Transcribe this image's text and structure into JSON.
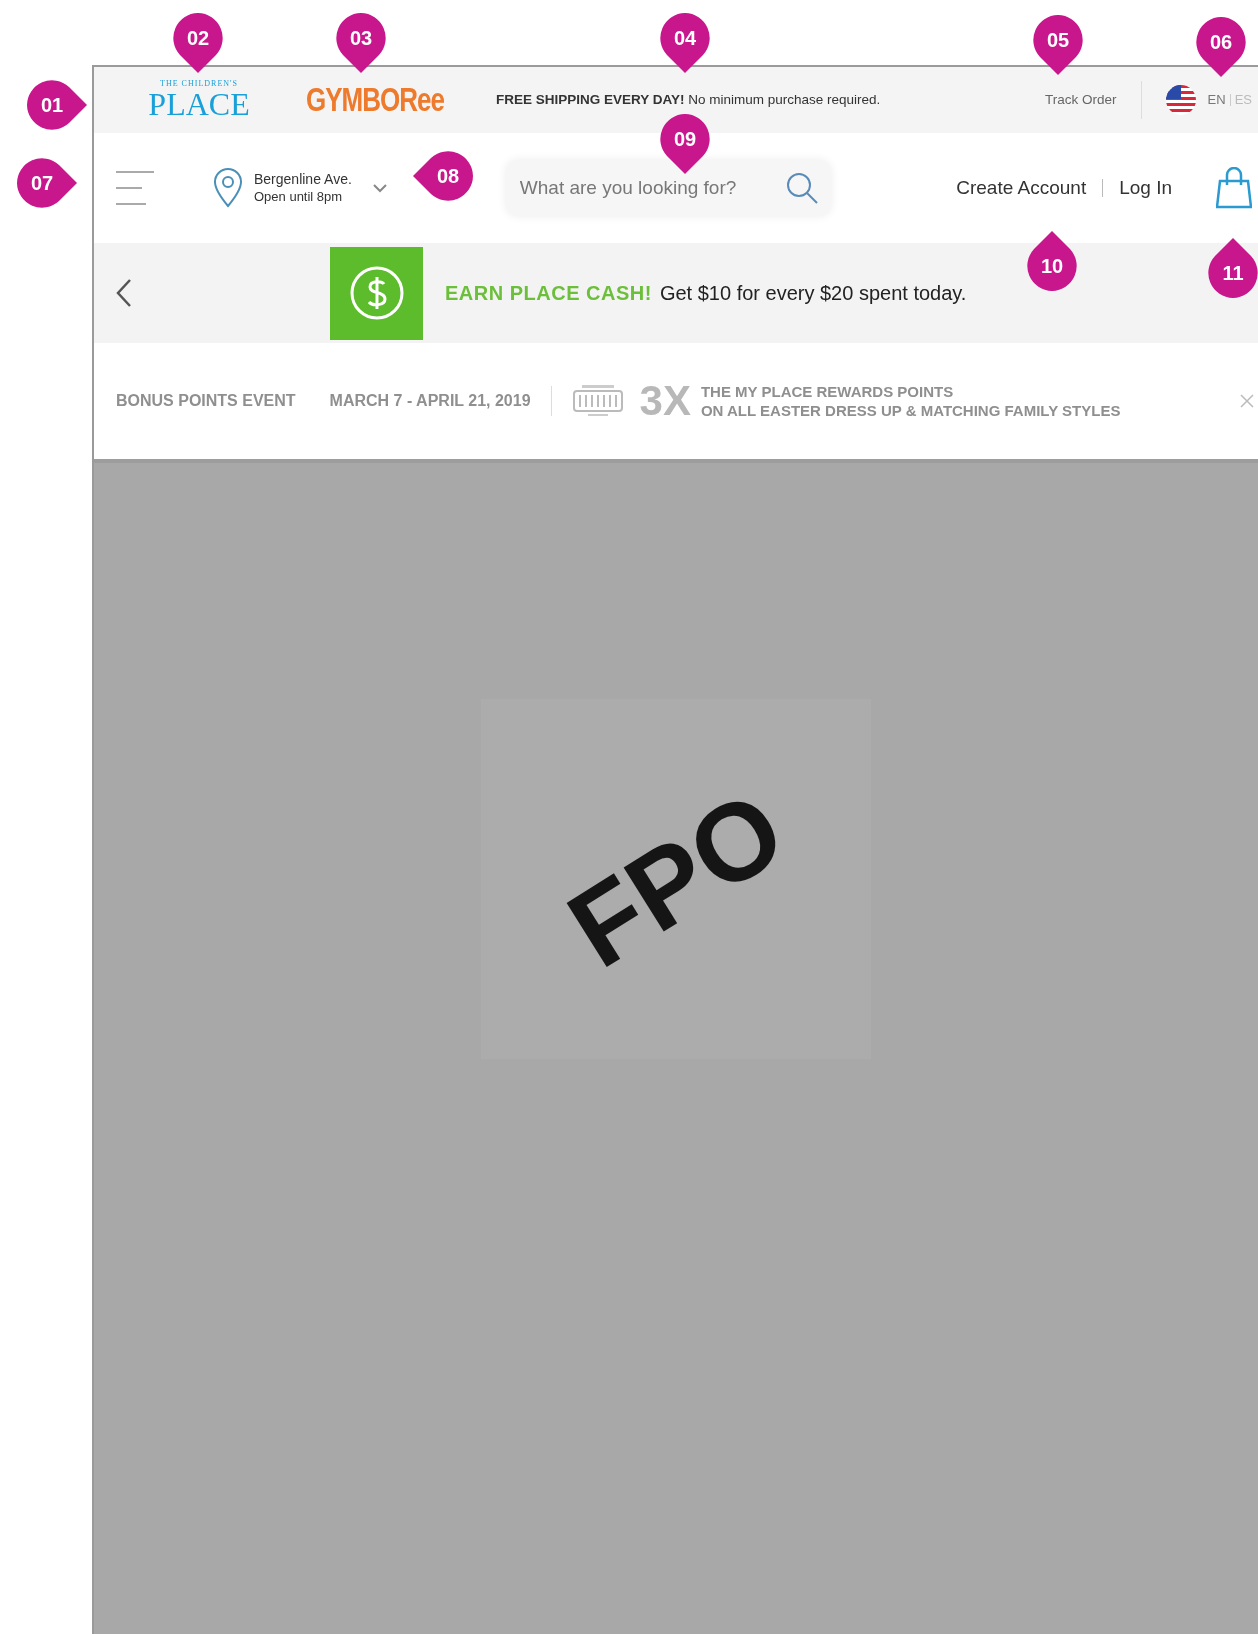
{
  "top_bar": {
    "logos": [
      {
        "kind": "place",
        "small": "THE CHILDREN'S",
        "large": "PLACE"
      },
      {
        "kind": "gymboree",
        "large": "GYMBORee"
      }
    ],
    "shipping": "**FREE SHIPPING EVERY DAY!** No minimum purchase required.",
    "track_order": "Track Order",
    "languages": [
      {
        "label": "EN",
        "selected": true
      },
      {
        "label": "ES",
        "selected": false
      }
    ]
  },
  "header": {
    "store": {
      "name": "Bergenline Ave.",
      "hours": "Open until 8pm"
    },
    "search": {
      "placeholder": "What are you looking for?"
    },
    "account_links": [
      "Create Account",
      "Log In"
    ]
  },
  "promo": {
    "headline": "EARN PLACE CASH!",
    "text": "Get $10 for every $20 spent today."
  },
  "bonus_strip": {
    "event": "BONUS POINTS EVENT",
    "dates": "MARCH 7 - APRIL 21, 2019",
    "multiplier": "3X",
    "line_1": "THE MY PLACE REWARDS POINTS",
    "line_2": "ON ALL EASTER DRESS UP & MATCHING FAMILY STYLES"
  },
  "hero": {
    "placeholder_text": "FPO"
  },
  "callouts": [
    {
      "label": "01",
      "kind": "right"
    },
    {
      "label": "02",
      "kind": "down"
    },
    {
      "label": "03",
      "kind": "down"
    },
    {
      "label": "04",
      "kind": "down"
    },
    {
      "label": "05",
      "kind": "down"
    },
    {
      "label": "06",
      "kind": "down"
    },
    {
      "label": "07",
      "kind": "right"
    },
    {
      "label": "08",
      "kind": "left"
    },
    {
      "label": "09",
      "kind": "down"
    },
    {
      "label": "10",
      "kind": "up"
    },
    {
      "label": "11",
      "kind": "up"
    }
  ]
}
